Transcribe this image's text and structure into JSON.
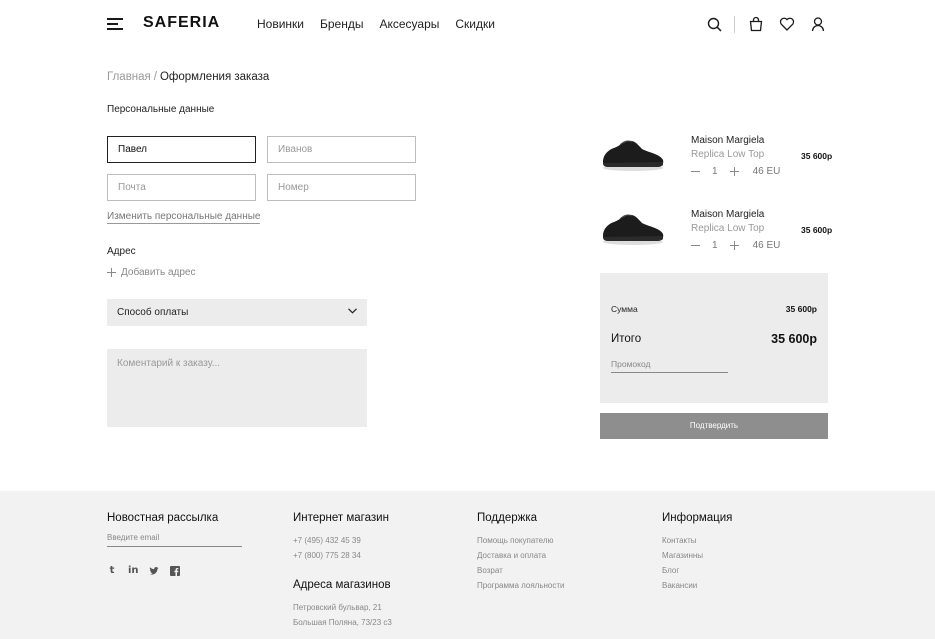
{
  "header": {
    "logo": "SAFERIA",
    "nav": [
      "Новинки",
      "Бренды",
      "Аксесуары",
      "Скидки"
    ],
    "icons": [
      "search-icon",
      "bag-icon",
      "heart-icon",
      "user-icon"
    ]
  },
  "breadcrumb": {
    "home": "Главная",
    "separator": "/",
    "current": "Оформления заказа"
  },
  "personal": {
    "title": "Персональные данные",
    "first_name": "Павел",
    "last_name_placeholder": "Иванов",
    "email_placeholder": "Почта",
    "phone_placeholder": "Номер",
    "edit_link": "Изменить персональные данные"
  },
  "address": {
    "title": "Адрес",
    "add_label": "Добавить адрес"
  },
  "payment": {
    "label": "Способ оплаты"
  },
  "comment": {
    "placeholder": "Коментарий к заказу..."
  },
  "cart": {
    "items": [
      {
        "brand": "Maison Margiela",
        "model": "Replica Low Top",
        "qty": "1",
        "size": "46 EU",
        "price": "35 600р"
      },
      {
        "brand": "Maison Margiela",
        "model": "Replica Low Top",
        "qty": "1",
        "size": "46 EU",
        "price": "35 600р"
      }
    ],
    "sum_label": "Сумма",
    "sum_value": "35 600р",
    "total_label": "Итого",
    "total_value": "35 600р",
    "promo_placeholder": "Промокод",
    "confirm_label": "Подтвердить"
  },
  "footer": {
    "newsletter": {
      "title": "Новостная рассылка",
      "email_placeholder": "Введите email",
      "socials": [
        "tumblr-icon",
        "linkedin-icon",
        "twitter-icon",
        "facebook-icon"
      ]
    },
    "shop": {
      "title": "Интернет магазин",
      "phones": [
        "+7 (495) 432 45 39",
        "+7 (800) 775 28 34"
      ],
      "stores_title": "Адреса магазинов",
      "addresses": [
        "Петровский бульвар, 21",
        "Большая Поляна, 73/23 с3"
      ]
    },
    "support": {
      "title": "Поддержка",
      "links": [
        "Помощь покупателю",
        "Доставка и оплата",
        "Возрат",
        "Программа лояльности"
      ]
    },
    "info": {
      "title": "Информация",
      "links": [
        "Контакты",
        "Магазинны",
        "Блог",
        "Вакансии"
      ]
    }
  },
  "colors": {
    "accent_gray": "#8e8e8e",
    "panel_bg": "#ececec",
    "footer_bg": "#f2f2f2"
  }
}
